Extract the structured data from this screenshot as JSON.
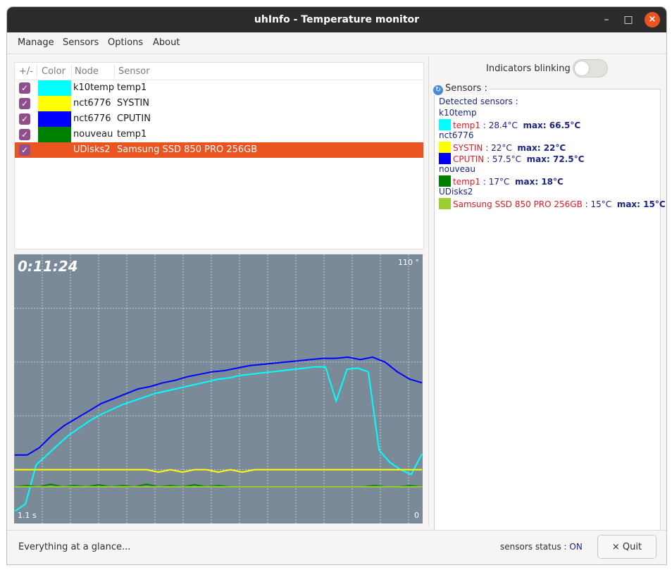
{
  "window": {
    "title": "uhInfo - Temperature monitor",
    "controls": {
      "minimize": "–",
      "maximize": "□",
      "close": "×"
    }
  },
  "menu": [
    "Manage",
    "Sensors",
    "Options",
    "About"
  ],
  "table": {
    "headers": {
      "toggle": "+/-",
      "color": "Color",
      "node": "Node",
      "sensor": "Sensor"
    },
    "rows": [
      {
        "checked": true,
        "color": "#00ffff",
        "node": "k10temp",
        "sensor": "temp1",
        "selected": false
      },
      {
        "checked": true,
        "color": "#ffff00",
        "node": "nct6776",
        "sensor": "SYSTIN",
        "selected": false
      },
      {
        "checked": true,
        "color": "#0000ff",
        "node": "nct6776",
        "sensor": "CPUTIN",
        "selected": false
      },
      {
        "checked": true,
        "color": "#008000",
        "node": "nouveau",
        "sensor": "temp1",
        "selected": false
      },
      {
        "checked": true,
        "color": "#9acd32",
        "node": "UDisks2",
        "sensor": "Samsung SSD 850 PRO 256GB",
        "selected": true
      }
    ]
  },
  "graph": {
    "elapsed": "0:11:24",
    "max_label": "110 °",
    "min_label": "0",
    "step_label": "1.1 s",
    "background": "#7a8a99",
    "y_range": [
      0,
      110
    ],
    "series": [
      {
        "color": "#0000ff",
        "values": [
          28,
          28,
          31,
          36,
          40,
          43,
          46,
          49,
          51,
          53,
          55,
          56,
          57.5,
          58.5,
          60,
          61,
          62,
          62.5,
          63.5,
          64.5,
          65,
          65.5,
          66,
          66.5,
          67,
          67.5,
          67.5,
          68,
          67,
          68,
          66,
          62,
          59,
          57.5
        ]
      },
      {
        "color": "#00ffff",
        "values": [
          5,
          8,
          24,
          28,
          32,
          36,
          39,
          42,
          44.5,
          46.5,
          48.5,
          50,
          51.5,
          53,
          54,
          55,
          56,
          57,
          58,
          59,
          59.5,
          60.5,
          61,
          61.5,
          62,
          62.5,
          63,
          63.5,
          64,
          64,
          50,
          63,
          63.5,
          62,
          30,
          25,
          22,
          20,
          28.4
        ]
      },
      {
        "color": "#ffff00",
        "values": [
          22,
          22,
          22,
          22,
          22,
          22,
          22,
          22,
          22,
          22,
          22,
          22,
          21,
          22,
          21,
          22,
          22,
          21,
          22,
          21,
          22,
          22,
          22,
          22,
          22,
          22,
          22,
          22,
          22,
          22,
          22,
          22,
          22,
          22,
          22
        ]
      },
      {
        "color": "#008000",
        "values": [
          15,
          15.5,
          15,
          16,
          15,
          15.5,
          15,
          15.8,
          15,
          15.5,
          15,
          16,
          15,
          15.5,
          15,
          15.8,
          15,
          15.5,
          15,
          15,
          15,
          15,
          15,
          15,
          15,
          15,
          15,
          15,
          15,
          15,
          15.5,
          15,
          15,
          15.5,
          15
        ]
      },
      {
        "color": "#9acd32",
        "values": [
          15,
          15,
          15,
          15,
          15,
          15,
          15,
          15,
          15,
          15,
          15,
          15,
          15,
          15,
          15,
          15,
          15,
          15,
          15,
          15,
          15,
          15,
          15,
          15,
          15,
          15,
          15,
          15,
          15,
          15,
          15,
          15,
          15,
          15,
          15
        ]
      }
    ]
  },
  "right": {
    "blink_label": "Indicators blinking",
    "blink_on": false,
    "frame_title": "Sensors :",
    "detected_label": "Detected sensors :",
    "groups": [
      {
        "node": "k10temp",
        "sensors": [
          {
            "name": "temp1",
            "value": " : 28.4°C",
            "max": "max: 66.5°C",
            "color": "#00ffff"
          }
        ]
      },
      {
        "node": "nct6776",
        "sensors": [
          {
            "name": "SYSTIN",
            "value": " : 22°C",
            "max": "max: 22°C",
            "color": "#ffff00"
          },
          {
            "name": "CPUTIN",
            "value": " : 57.5°C",
            "max": "max: 72.5°C",
            "color": "#0000ff"
          }
        ]
      },
      {
        "node": "nouveau",
        "sensors": [
          {
            "name": "temp1",
            "value": " : 17°C",
            "max": "max: 18°C",
            "color": "#008000"
          }
        ]
      },
      {
        "node": "UDisks2",
        "sensors": [
          {
            "name": "Samsung SSD 850 PRO 256GB",
            "value": " : 15°C",
            "max": "max: 15°C",
            "color": "#9acd32"
          }
        ]
      }
    ]
  },
  "status": {
    "message": "Everything at a glance...",
    "sensors_status_label": "sensors status :",
    "sensors_status_value": "ON",
    "quit_label": "Quit",
    "quit_icon": "×"
  }
}
